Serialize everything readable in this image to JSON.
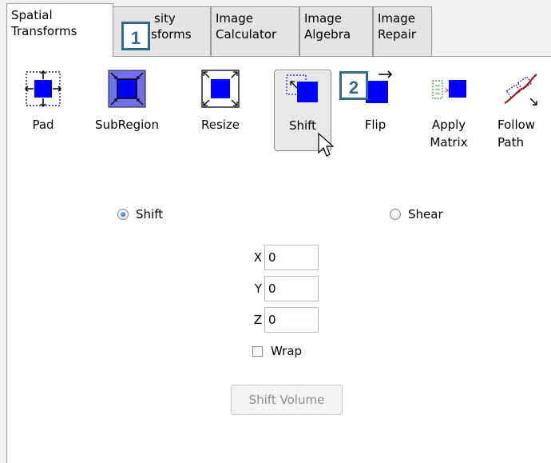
{
  "tabs": [
    {
      "line1": "Spatial",
      "line2": "Transforms",
      "active": true
    },
    {
      "line1": "Intensity",
      "line2": "Transforms",
      "active": false
    },
    {
      "line1": "Image",
      "line2": "Calculator",
      "active": false
    },
    {
      "line1": "Image",
      "line2": "Algebra",
      "active": false
    },
    {
      "line1": "Image",
      "line2": "Repair",
      "active": false
    }
  ],
  "tab_visible": {
    "intensity_line1": "sity",
    "intensity_line2": "sforms"
  },
  "tools": [
    {
      "label": "Pad"
    },
    {
      "label": "SubRegion"
    },
    {
      "label": "Resize"
    },
    {
      "label": "Shift"
    },
    {
      "label": "Flip"
    },
    {
      "label": "Apply\nMatrix"
    },
    {
      "label": "Follow\nPath"
    }
  ],
  "callouts": {
    "one": "1",
    "two": "2"
  },
  "mode": {
    "shift_label": "Shift",
    "shear_label": "Shear",
    "selected": "shift"
  },
  "fields": {
    "x_label": "X",
    "x_value": "0",
    "y_label": "Y",
    "y_value": "0",
    "z_label": "Z",
    "z_value": "0"
  },
  "wrap": {
    "label": "Wrap",
    "checked": false
  },
  "action": {
    "label": "Shift Volume",
    "enabled": false
  },
  "colors": {
    "accent_blue": "#0000ff",
    "callout": "#2f6b8e"
  }
}
